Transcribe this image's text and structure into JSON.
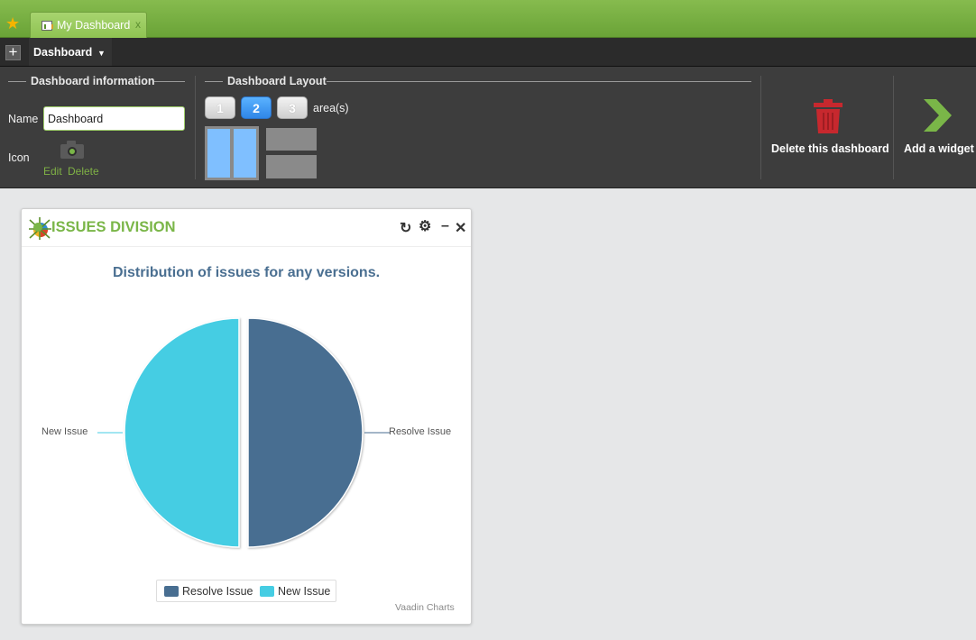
{
  "tabbar": {
    "tab_label": "My Dashboard",
    "tab_close": "x"
  },
  "menubar": {
    "plus": "+",
    "menu_label": "Dashboard",
    "menu_caret": "▼"
  },
  "dashboard_info": {
    "legend": "Dashboard information",
    "name_label": "Name",
    "name_value": "Dashboard",
    "icon_label": "Icon",
    "edit_link": "Edit",
    "delete_link": "Delete"
  },
  "dashboard_layout": {
    "legend": "Dashboard Layout",
    "area_buttons": [
      "1",
      "2",
      "3"
    ],
    "selected_area": "2",
    "area_suffix": "area(s)"
  },
  "actions": {
    "delete_label": "Delete this dashboard",
    "add_label": "Add a widget"
  },
  "widget": {
    "title": "ISSUES DIVISION",
    "refresh_icon": "↻",
    "settings_icon": "⚙",
    "minimize_icon": "–",
    "close_icon": "✕",
    "credit": "Vaadin Charts"
  },
  "colors": {
    "accent_green": "#7ab648",
    "resolve": "#486e91",
    "new": "#45cde3",
    "trash_red": "#c7282e",
    "layout_blue": "#7fbfff"
  },
  "chart_data": {
    "type": "pie",
    "title": "Distribution of issues for any versions.",
    "series": [
      {
        "name": "Resolve Issue",
        "value": 50,
        "color": "#486e91"
      },
      {
        "name": "New Issue",
        "value": 50,
        "color": "#45cde3"
      }
    ],
    "legend_position": "bottom-center"
  }
}
